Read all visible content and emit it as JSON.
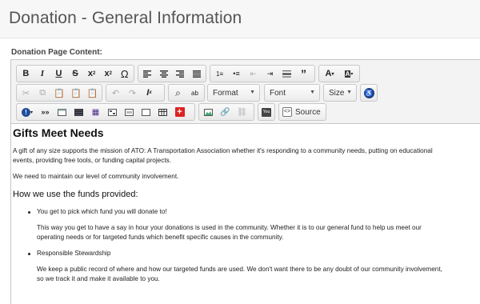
{
  "page": {
    "title": "Donation - General Information"
  },
  "form": {
    "field_label": "Donation Page Content:"
  },
  "toolbar": {
    "format_label": "Format",
    "font_label": "Font",
    "size_label": "Size",
    "source_label": "Source"
  },
  "content": {
    "heading": "Gifts Meet Needs",
    "intro_line1": "A gift of any size supports the mission of ATO: A Transportation Association whether it's responding to a community needs, putting on educational",
    "intro_line2": "events, providing free tools, or funding capital projects.",
    "involvement": "We need to maintain our level of community involvement.",
    "subheading": "How we use the funds provided:",
    "items": [
      {
        "title": "You get to pick which fund you will donate to!",
        "body_line1": "This way you get to have a say in hour your donations is used in the community. Whether it is to our general fund to help us meet our",
        "body_line2": "operating needs or for targeted funds which benefit specific causes in the community."
      },
      {
        "title": "Responsible Stewardship",
        "body_line1": "We keep a public record of where and how our targeted funds are used. We don't want there to be any doubt of our community involvement,",
        "body_line2": "so we track it and make it available to you."
      }
    ]
  }
}
